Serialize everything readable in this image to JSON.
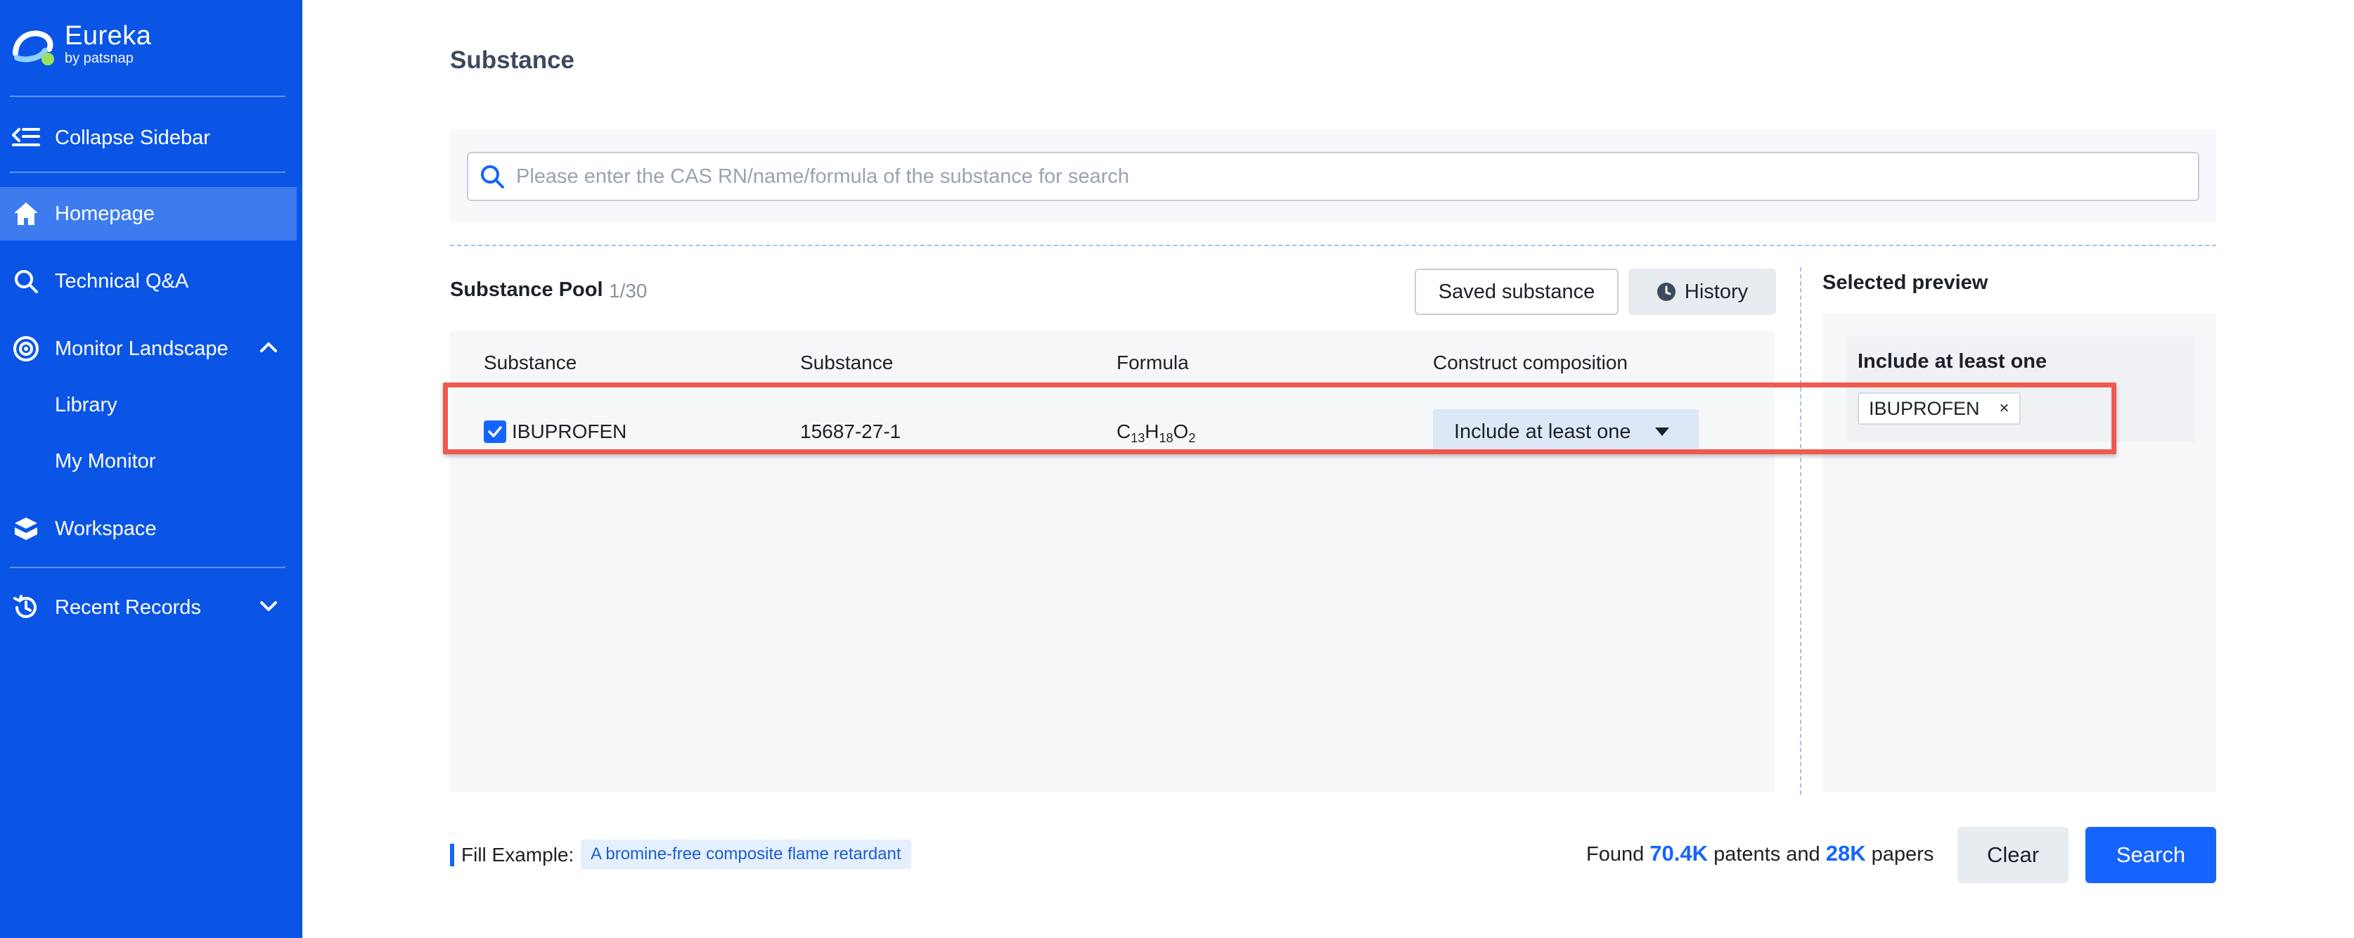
{
  "app": {
    "logo_text": "Eureka",
    "logo_sub": "by patsnap"
  },
  "sidebar": {
    "collapse_label": "Collapse Sidebar",
    "items": [
      {
        "label": "Homepage",
        "icon": "home-icon",
        "active": true
      },
      {
        "label": "Technical Q&A",
        "icon": "search-icon"
      },
      {
        "label": "Monitor Landscape",
        "icon": "monitor-icon"
      },
      {
        "label": "Workspace",
        "icon": "workspace-icon"
      },
      {
        "label": "Recent Records",
        "icon": "history-icon"
      }
    ],
    "sub_items": [
      "Library",
      "My Monitor"
    ]
  },
  "page": {
    "title": "Substance"
  },
  "search": {
    "placeholder": "Please enter the CAS RN/name/formula of the substance for search",
    "value": ""
  },
  "pool": {
    "title": "Substance Pool",
    "count": "1/30",
    "saved_button": "Saved substance",
    "history_button": "History",
    "columns": [
      "Substance",
      "Substance",
      "Formula",
      "Construct composition"
    ],
    "rows": [
      {
        "checked": true,
        "name": "IBUPROFEN",
        "cas": "15687-27-1",
        "formula": {
          "c": "C",
          "c_n": "13",
          "h": "H",
          "h_n": "18",
          "o": "O",
          "o_n": "2"
        },
        "composition": "Include at least one"
      }
    ]
  },
  "preview": {
    "title": "Selected preview",
    "group_title": "Include at least one",
    "tags": [
      "IBUPROFEN"
    ],
    "tag_remove": "×"
  },
  "footer": {
    "fill_label": "Fill Example:",
    "example": "A bromine-free composite flame retardant",
    "found_prefix": "Found",
    "patents_count": "70.4K",
    "patents_text": "patents and",
    "papers_count": "28K",
    "papers_text": "papers",
    "clear_button": "Clear",
    "search_button": "Search"
  },
  "colors": {
    "sidebar": "#0b55e6",
    "accent": "#1664ff",
    "highlight": "#ef5a4f"
  }
}
